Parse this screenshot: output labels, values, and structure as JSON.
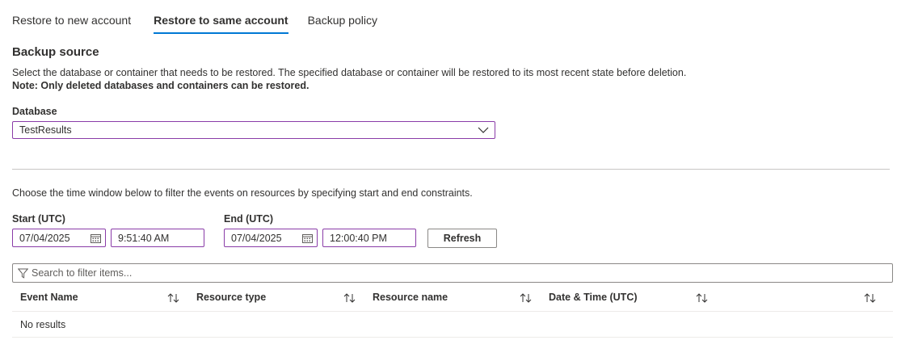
{
  "tabs": [
    {
      "label": "Restore to new account",
      "active": false
    },
    {
      "label": "Restore to same account",
      "active": true
    },
    {
      "label": "Backup policy",
      "active": false
    }
  ],
  "section": {
    "title": "Backup source",
    "description": "Select the database or container that needs to be restored. The specified database or container will be restored to its most recent state before deletion.",
    "note": "Note: Only deleted databases and containers can be restored."
  },
  "database": {
    "label": "Database",
    "selected": "TestResults"
  },
  "time_window": {
    "hint": "Choose the time window below to filter the events on resources by specifying start and end constraints.",
    "start_label": "Start (UTC)",
    "start_date": "07/04/2025",
    "start_time": "9:51:40 AM",
    "end_label": "End (UTC)",
    "end_date": "07/04/2025",
    "end_time": "12:00:40 PM",
    "refresh_label": "Refresh"
  },
  "filter": {
    "placeholder": "Search to filter items..."
  },
  "table": {
    "columns": [
      "Event Name",
      "Resource type",
      "Resource name",
      "Date & Time (UTC)"
    ],
    "empty_text": "No results"
  },
  "colors": {
    "accent": "#0078d4",
    "focus_border": "#8a3ca8",
    "text": "#323130"
  }
}
